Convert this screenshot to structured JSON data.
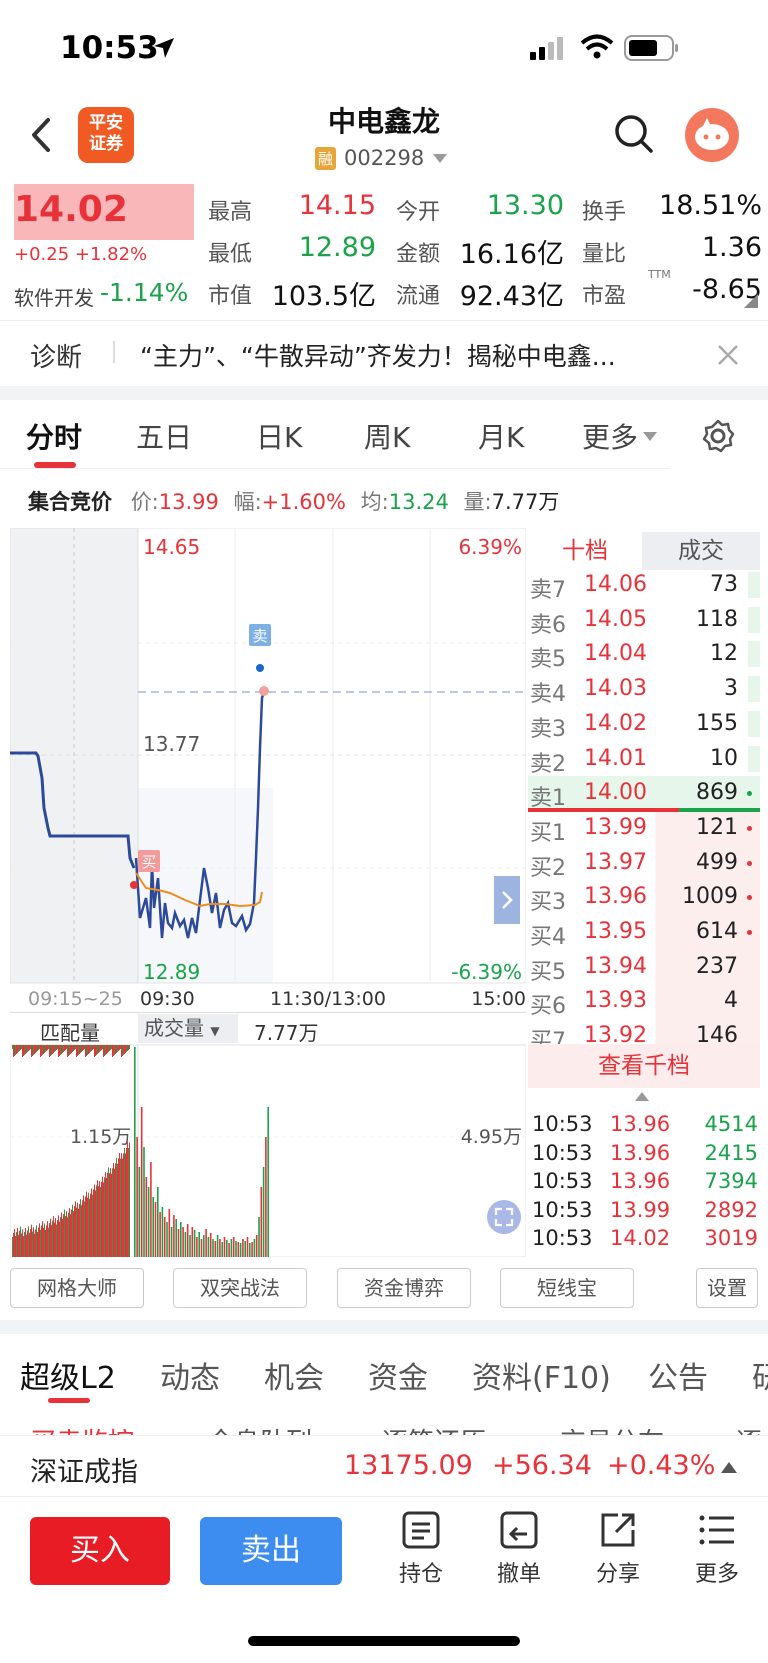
{
  "status": {
    "time": "10:53"
  },
  "header": {
    "broker_logo": "平安\n证券",
    "title": "中电鑫龙",
    "rong": "融",
    "code": "002298"
  },
  "quote": {
    "price": "14.02",
    "change": "+0.25 +1.82%",
    "sector": "软件开发",
    "sector_change": "-1.14%",
    "fields": [
      {
        "label": "最高",
        "value": "14.15",
        "color": "red"
      },
      {
        "label": "今开",
        "value": "13.30",
        "color": "green"
      },
      {
        "label": "换手",
        "value": "18.51%",
        "color": "black"
      },
      {
        "label": "最低",
        "value": "12.89",
        "color": "green"
      },
      {
        "label": "金额",
        "value": "16.16亿",
        "color": "black"
      },
      {
        "label": "量比",
        "value": "1.36",
        "color": "black"
      },
      {
        "label": "市值",
        "value": "103.5亿",
        "color": "black"
      },
      {
        "label": "流通",
        "value": "92.43亿",
        "color": "black"
      },
      {
        "label": "市盈",
        "value": "-8.65",
        "color": "black"
      }
    ],
    "ttm": "TTM"
  },
  "diagnosis": {
    "label": "诊断",
    "text": "“主力”、“牛散异动”齐发力！揭秘中电鑫..."
  },
  "tabs": [
    "分时",
    "五日",
    "日K",
    "周K",
    "月K",
    "更多"
  ],
  "auction": {
    "label": "集合竞价",
    "price_label": "价:",
    "price": "13.99",
    "range_label": "幅:",
    "range": "+1.60%",
    "avg_label": "均:",
    "avg": "13.24",
    "vol_label": "量:",
    "vol": "7.77万"
  },
  "chart": {
    "high": "14.65",
    "mid": "13.77",
    "low": "12.89",
    "pct_high": "6.39%",
    "pct_low": "-6.39%",
    "sell_marker": "卖",
    "buy_marker": "买",
    "x_labels": [
      "09:15~25",
      "09:30",
      "11:30/13:00",
      "15:00"
    ]
  },
  "volume": {
    "match_label": "匹配量",
    "vol_selector": "成交量",
    "vol_value": "7.77万",
    "left_tick": "1.15万",
    "right_tick": "4.95万"
  },
  "orderbook": {
    "tab_ten": "十档",
    "tab_deal": "成交",
    "asks": [
      {
        "l": "卖7",
        "p": "14.06",
        "v": "73"
      },
      {
        "l": "卖6",
        "p": "14.05",
        "v": "118"
      },
      {
        "l": "卖5",
        "p": "14.04",
        "v": "12"
      },
      {
        "l": "卖4",
        "p": "14.03",
        "v": "3"
      },
      {
        "l": "卖3",
        "p": "14.02",
        "v": "155"
      },
      {
        "l": "卖2",
        "p": "14.01",
        "v": "10"
      },
      {
        "l": "卖1",
        "p": "14.00",
        "v": "869"
      }
    ],
    "bids": [
      {
        "l": "买1",
        "p": "13.99",
        "v": "121"
      },
      {
        "l": "买2",
        "p": "13.97",
        "v": "499"
      },
      {
        "l": "买3",
        "p": "13.96",
        "v": "1009"
      },
      {
        "l": "买4",
        "p": "13.95",
        "v": "614"
      },
      {
        "l": "买5",
        "p": "13.94",
        "v": "237"
      },
      {
        "l": "买6",
        "p": "13.93",
        "v": "4"
      },
      {
        "l": "买7",
        "p": "13.92",
        "v": "146"
      }
    ],
    "view_all": "查看千档",
    "trades": [
      {
        "t": "10:53",
        "p": "13.96",
        "v": "4514"
      },
      {
        "t": "10:53",
        "p": "13.96",
        "v": "2415"
      },
      {
        "t": "10:53",
        "p": "13.96",
        "v": "7394"
      },
      {
        "t": "10:53",
        "p": "13.99",
        "v": "2892"
      },
      {
        "t": "10:53",
        "p": "14.02",
        "v": "3019"
      }
    ]
  },
  "tools": [
    "网格大师",
    "双突战法",
    "资金博弈",
    "短线宝",
    "设置"
  ],
  "bottom_tabs": [
    "超级L2",
    "动态",
    "机会",
    "资金",
    "资料(F10)",
    "公告",
    "研"
  ],
  "subtabs": [
    "买卖监控",
    "全息队列",
    "逐笔还原",
    "交易分布",
    "逐"
  ],
  "index": {
    "name": "深证成指",
    "value": "13175.09",
    "change": "+56.34",
    "pct": "+0.43%"
  },
  "actions": {
    "buy": "买入",
    "sell": "卖出",
    "hold": "持仓",
    "cancel": "撤单",
    "share": "分享",
    "more": "更多"
  }
}
